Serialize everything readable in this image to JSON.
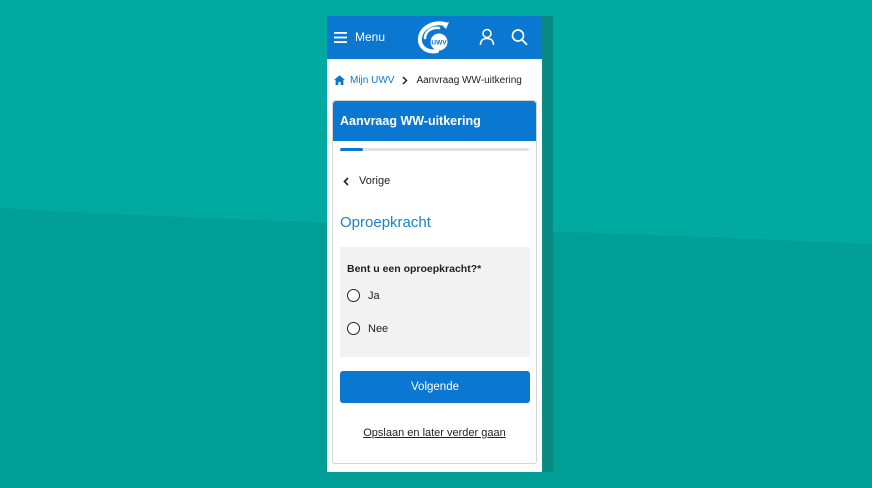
{
  "colors": {
    "background": "#00a59c",
    "brand_blue": "#0a78d0",
    "link_blue": "#1a84c8",
    "question_bg": "#f2f2f2"
  },
  "header": {
    "menu_icon": "hamburger-menu-icon",
    "menu_label": "Menu",
    "logo_text": "UWV",
    "user_icon": "user-icon",
    "search_icon": "search-icon"
  },
  "breadcrumb": {
    "home_icon": "home-icon",
    "home_label": "Mijn UWV",
    "separator_icon": "chevron-right-icon",
    "current_label": "Aanvraag WW-uitkering"
  },
  "form": {
    "title": "Aanvraag WW-uitkering",
    "progress_fraction": 0.12,
    "back_label": "Vorige",
    "section_title": "Oproepkracht",
    "question": "Bent u een oproepkracht?*",
    "options": [
      {
        "label": "Ja",
        "selected": false
      },
      {
        "label": "Nee",
        "selected": false
      }
    ],
    "next_label": "Volgende",
    "save_label": "Opslaan en later verder gaan"
  }
}
